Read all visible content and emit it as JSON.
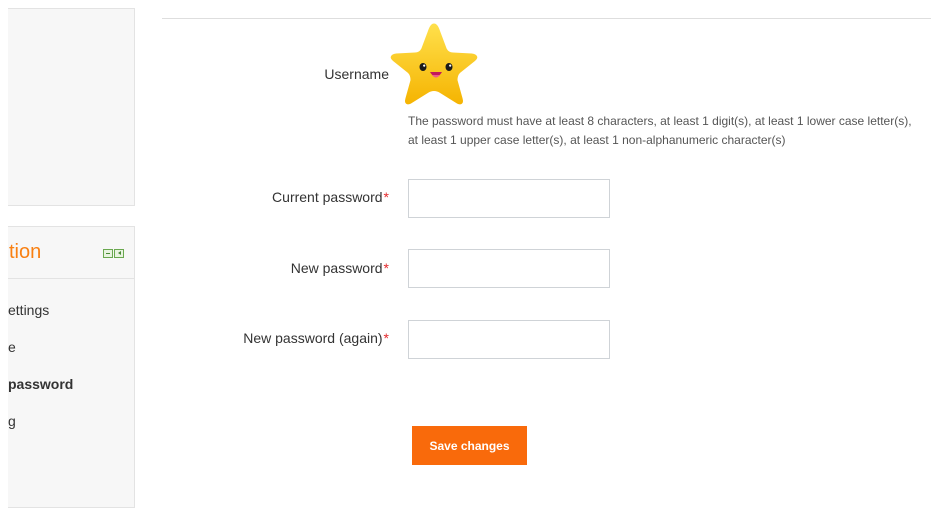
{
  "sidebar": {
    "nav_title": "tion",
    "items": [
      {
        "label": "ettings",
        "active": false
      },
      {
        "label": "e",
        "active": false
      },
      {
        "label": "password",
        "active": true
      },
      {
        "label": "g",
        "active": false
      }
    ]
  },
  "form": {
    "username_label": "Username",
    "password_policy": "The password must have at least 8 characters, at least 1 digit(s), at least 1 lower case letter(s), at least 1 upper case letter(s), at least 1 non-alphanumeric character(s)",
    "current_password": {
      "label": "Current password",
      "value": ""
    },
    "new_password": {
      "label": "New password",
      "value": ""
    },
    "new_password_again": {
      "label": "New password (again)",
      "value": ""
    },
    "required_marker": "*",
    "save_label": "Save changes"
  },
  "colors": {
    "accent_orange": "#f98012",
    "button_orange": "#f96a0b",
    "required_red": "#e4282b",
    "star_yellow": "#fbc02d"
  },
  "icons": {
    "avatar": "star-face-icon",
    "block_controls": [
      "collapse-icon",
      "dock-icon"
    ]
  }
}
